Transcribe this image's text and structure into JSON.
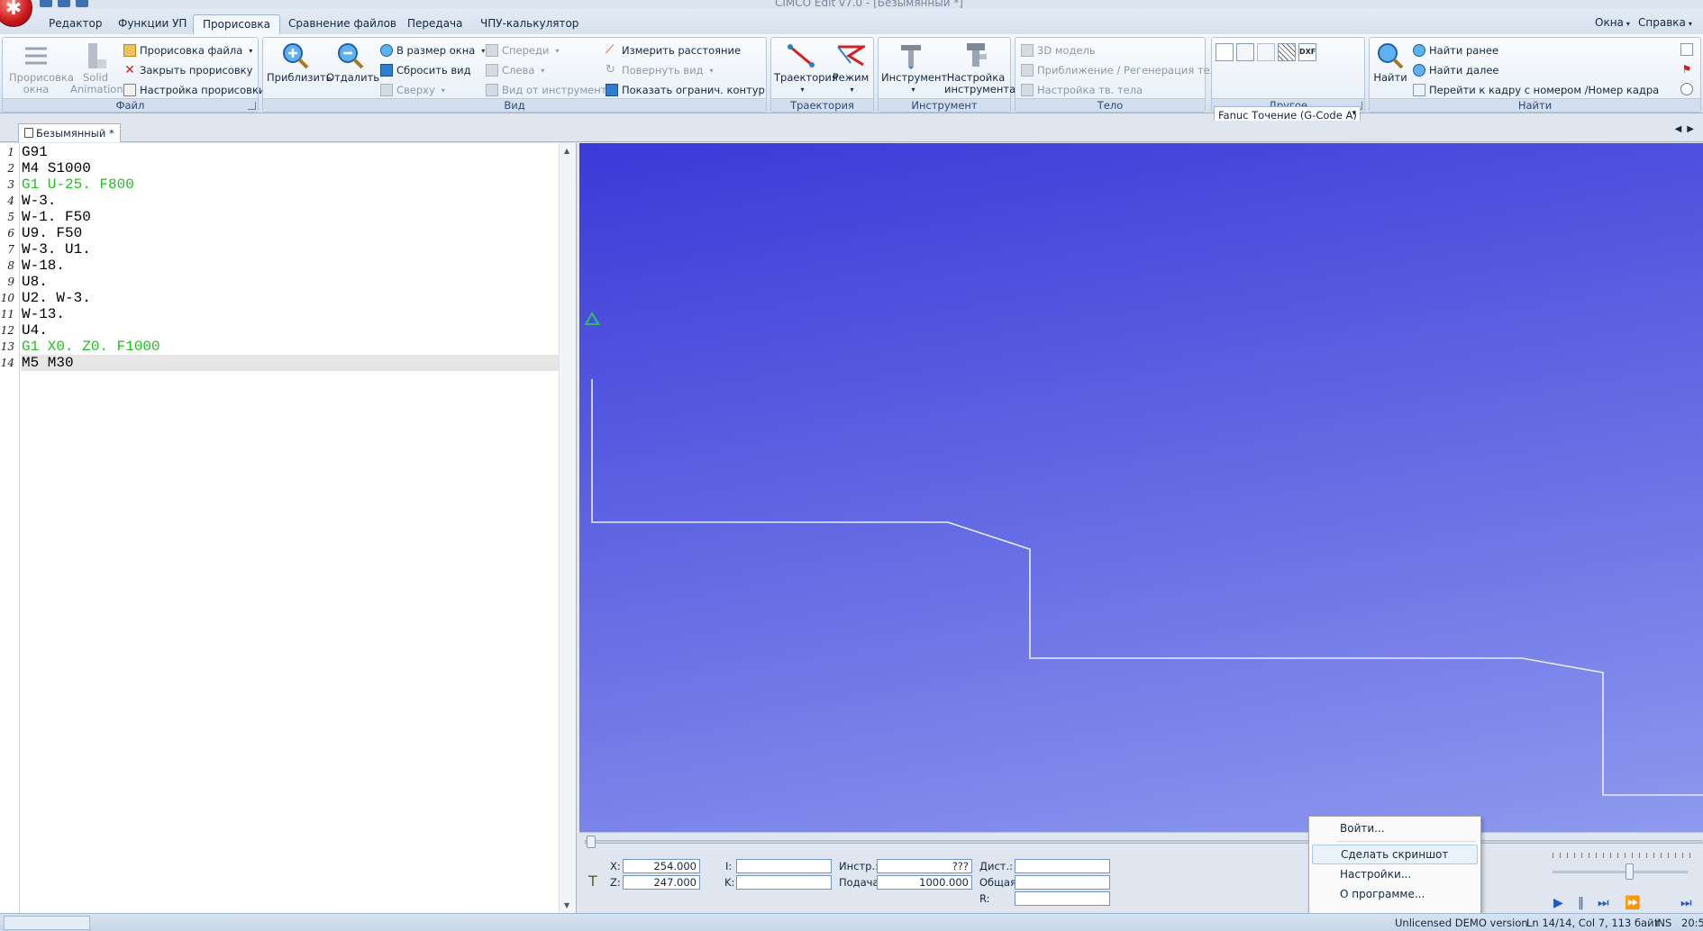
{
  "window": {
    "title": "CIMCO Edit v7.0 - [Безымянный *]"
  },
  "menu": {
    "tabs": [
      "Редактор",
      "Функции УП",
      "Прорисовка",
      "Сравнение файлов",
      "Передача",
      "ЧПУ-калькулятор"
    ],
    "active_tab": "Прорисовка",
    "right": [
      "Окна",
      "Справка"
    ]
  },
  "ribbon": {
    "file": {
      "caption": "Файл",
      "backplot_window": "Прорисовка окна",
      "solid_animation": "Solid Animation",
      "backplot_file": "Прорисовка файла",
      "close_backplot": "Закрыть прорисовку",
      "backplot_settings": "Настройка прорисовки"
    },
    "view": {
      "caption": "Вид",
      "zoom_in": "Приблизить",
      "zoom_out": "Отдалить",
      "fit_window": "В размер окна",
      "reset_view": "Сбросить вид",
      "top": "Сверху",
      "front": "Спереди",
      "left": "Слева",
      "tool_view": "Вид от инструмента",
      "measure": "Измерить расстояние",
      "rotate": "Повернуть вид",
      "show_bound": "Показать огранич. контур"
    },
    "trajectory": {
      "caption": "Траектория",
      "path": "Траектория",
      "mode": "Режим"
    },
    "tool": {
      "caption": "Инструмент",
      "tool": "Инструмент",
      "tool_setup": "Настройка инструмента"
    },
    "solid": {
      "caption": "Тело",
      "model3d": "3D модель",
      "zoom_regen": "Приближение / Регенерация тела",
      "solid_setup": "Настройка тв. тела"
    },
    "other": {
      "caption": "Другое",
      "machine": "Fanuc Точение (G-Code A)",
      "dxf": "DXF"
    },
    "find": {
      "caption": "Найти",
      "find": "Найти",
      "find_prev": "Найти ранее",
      "find_next": "Найти далее",
      "goto_block": "Перейти к кадру с номером /Номер кадра"
    }
  },
  "document": {
    "tab": "Безымянный *"
  },
  "editor": {
    "lines": [
      {
        "n": "1",
        "text": "G91",
        "color": "black"
      },
      {
        "n": "2",
        "text": "M4 S1000",
        "color": "black"
      },
      {
        "n": "3",
        "text": "G1 U-25. F800",
        "color": "green"
      },
      {
        "n": "4",
        "text": "W-3.",
        "color": "black"
      },
      {
        "n": "5",
        "text": "W-1. F50",
        "color": "black"
      },
      {
        "n": "6",
        "text": "U9. F50",
        "color": "black"
      },
      {
        "n": "7",
        "text": "W-3. U1.",
        "color": "black"
      },
      {
        "n": "8",
        "text": "W-18.",
        "color": "black"
      },
      {
        "n": "9",
        "text": "U8.",
        "color": "black"
      },
      {
        "n": "10",
        "text": "U2. W-3.",
        "color": "black"
      },
      {
        "n": "11",
        "text": "W-13.",
        "color": "black"
      },
      {
        "n": "12",
        "text": "U4.",
        "color": "black"
      },
      {
        "n": "13",
        "text": "G1 X0. Z0. F1000",
        "color": "green"
      },
      {
        "n": "14",
        "text": "M5 M30",
        "color": "black"
      }
    ],
    "current_line": 14
  },
  "viewport": {
    "background_top": "#3a3ad8",
    "background_bottom": "#8e99ee",
    "path_color": "#e8ecf6",
    "tool_marker_color": "#22dd44"
  },
  "coords": {
    "x_label": "X:",
    "x_value": "254.000",
    "z_label": "Z:",
    "z_value": "247.000",
    "i_label": "I:",
    "i_value": "",
    "k_label": "K:",
    "k_value": "",
    "tool_label": "Инстр.:",
    "tool_value": "???",
    "feed_label": "Подача:",
    "feed_value": "1000.000",
    "dist_label": "Дист.:",
    "dist_value": "",
    "total_label": "Общая:",
    "total_value": "",
    "r_label": "R:",
    "r_value": ""
  },
  "context_menu": {
    "items": [
      "Войти...",
      "Сделать скриншот",
      "Настройки...",
      "О программе..."
    ],
    "highlighted": "Сделать скриншот"
  },
  "statusbar": {
    "license": "Unlicensed DEMO version",
    "position": "Ln 14/14, Col 7, 113 байт",
    "mode": "INS",
    "time": "20:5"
  }
}
